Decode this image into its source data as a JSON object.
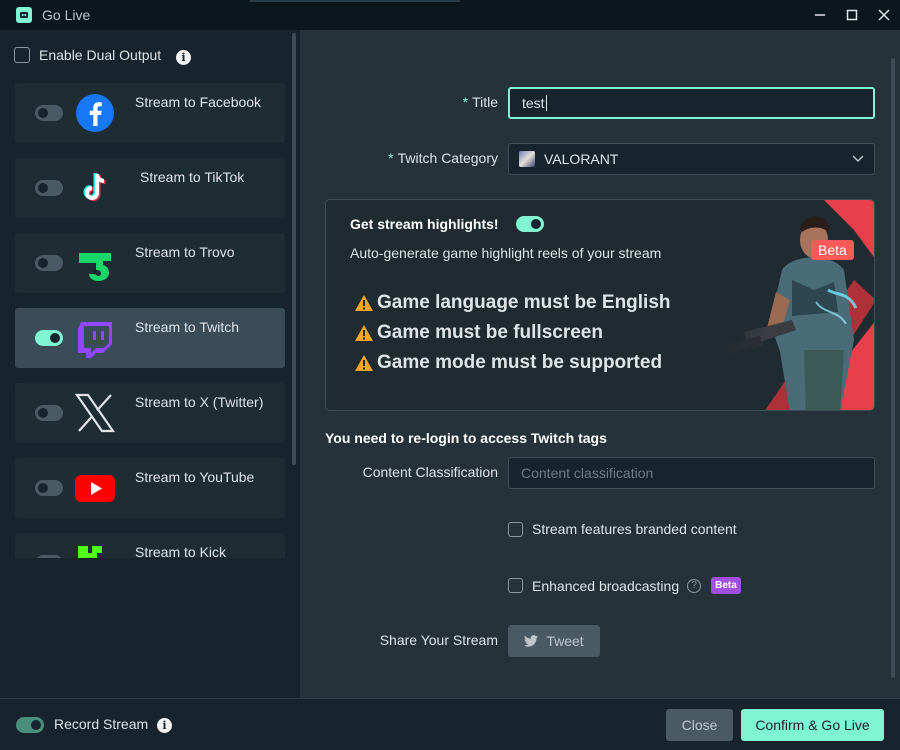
{
  "window": {
    "title": "Go Live"
  },
  "left": {
    "dual_output_label": "Enable Dual Output",
    "platforms": [
      {
        "label": "Stream to Facebook",
        "enabled": false
      },
      {
        "label": "Stream to TikTok",
        "enabled": false
      },
      {
        "label": "Stream to Trovo",
        "enabled": false
      },
      {
        "label": "Stream to Twitch",
        "enabled": true
      },
      {
        "label": "Stream to X (Twitter)",
        "enabled": false
      },
      {
        "label": "Stream to YouTube",
        "enabled": false
      },
      {
        "label": "Stream to Kick",
        "enabled": false
      }
    ]
  },
  "form": {
    "title_label": "Title",
    "title_value": "test",
    "category_label": "Twitch Category",
    "category_value": "VALORANT",
    "highlights": {
      "title": "Get stream highlights!",
      "enabled": true,
      "subtitle": "Auto-generate game highlight reels of your stream",
      "warnings": [
        "Game language must be English",
        "Game must be fullscreen",
        "Game mode must be supported"
      ],
      "badge": "Beta"
    },
    "relogin_text": "You need to re-login to access Twitch tags",
    "content_class_label": "Content Classification",
    "content_class_placeholder": "Content classification",
    "branded_label": "Stream features branded content",
    "enhanced_label": "Enhanced broadcasting",
    "enhanced_badge": "Beta",
    "share_label": "Share Your Stream",
    "tweet_label": "Tweet"
  },
  "footer": {
    "record_label": "Record Stream",
    "record_enabled": true,
    "close_label": "Close",
    "confirm_label": "Confirm & Go Live"
  },
  "colors": {
    "accent": "#80f5d2",
    "background": "#17242d",
    "panel": "#253239",
    "beta_red": "#f85a5a",
    "beta_purple": "#a14fe3"
  }
}
